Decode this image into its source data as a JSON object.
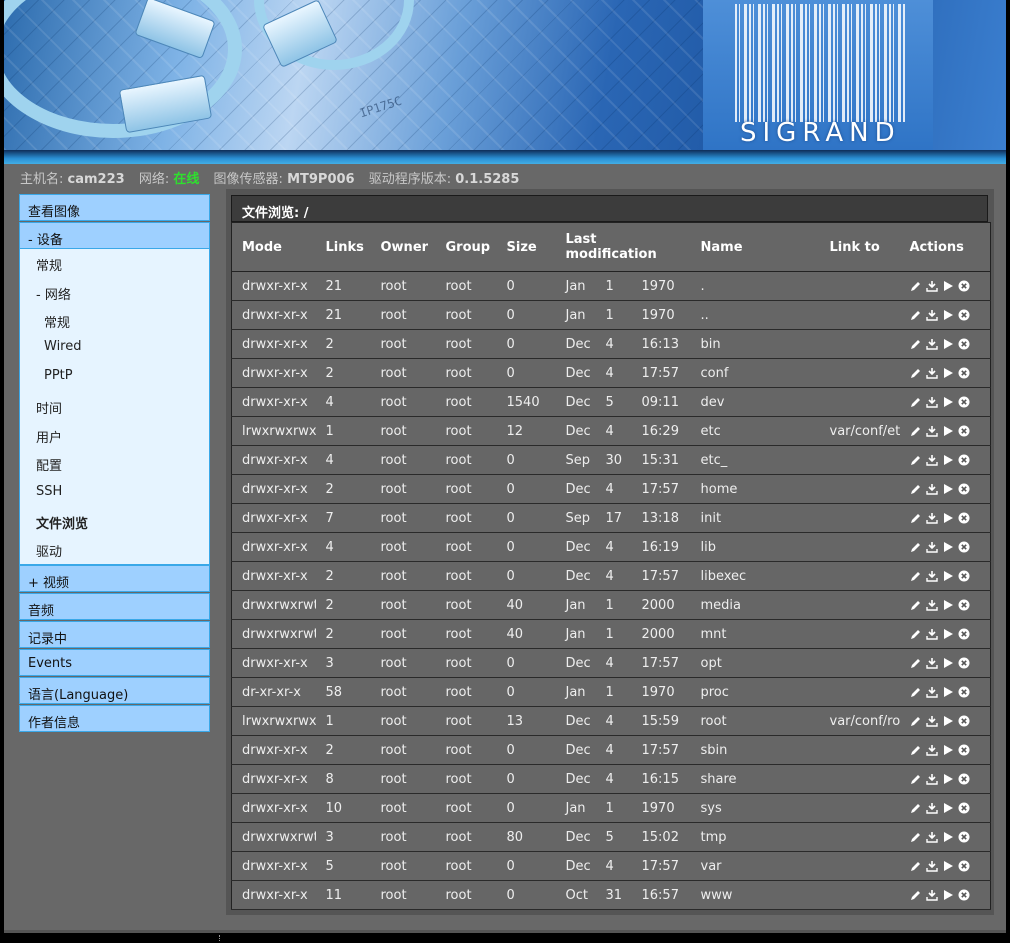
{
  "status": {
    "host_label": "主机名:",
    "host_value": "cam223",
    "network_label": "网络:",
    "network_value": "在线",
    "sensor_label": "图像传感器:",
    "sensor_value": "MT9P006",
    "driver_label": "驱动程序版本:",
    "driver_value": "0.1.5285"
  },
  "banner": {
    "logo": "SIGRAND",
    "chip_text": "IP175C"
  },
  "sidebar": {
    "view_image": "查看图像",
    "devices": "- 设备",
    "devices_sub": [
      "常规",
      "- 网络"
    ],
    "network_sub": [
      "常规",
      "Wired",
      "PPtP"
    ],
    "devices_sub2": [
      "时间",
      "用户",
      "配置",
      "SSH",
      "文件浏览",
      "驱动"
    ],
    "video": "+ 视频",
    "audio": "音频",
    "recording": "记录中",
    "events": "Events",
    "language": "语言(Language)",
    "author": "作者信息"
  },
  "file_browser": {
    "title": "文件浏览: /",
    "columns": [
      "Mode",
      "Links",
      "Owner",
      "Group",
      "Size",
      "Last modification",
      "Name",
      "Link to",
      "Actions"
    ],
    "rows": [
      {
        "mode": "drwxr-xr-x",
        "links": "21",
        "owner": "root",
        "group": "root",
        "size": "0",
        "mon": "Jan",
        "day": "1",
        "time": "1970",
        "name": ".",
        "link": ""
      },
      {
        "mode": "drwxr-xr-x",
        "links": "21",
        "owner": "root",
        "group": "root",
        "size": "0",
        "mon": "Jan",
        "day": "1",
        "time": "1970",
        "name": "..",
        "link": ""
      },
      {
        "mode": "drwxr-xr-x",
        "links": "2",
        "owner": "root",
        "group": "root",
        "size": "0",
        "mon": "Dec",
        "day": "4",
        "time": "16:13",
        "name": "bin",
        "link": ""
      },
      {
        "mode": "drwxr-xr-x",
        "links": "2",
        "owner": "root",
        "group": "root",
        "size": "0",
        "mon": "Dec",
        "day": "4",
        "time": "17:57",
        "name": "conf",
        "link": ""
      },
      {
        "mode": "drwxr-xr-x",
        "links": "4",
        "owner": "root",
        "group": "root",
        "size": "1540",
        "mon": "Dec",
        "day": "5",
        "time": "09:11",
        "name": "dev",
        "link": ""
      },
      {
        "mode": "lrwxrwxrwx",
        "links": "1",
        "owner": "root",
        "group": "root",
        "size": "12",
        "mon": "Dec",
        "day": "4",
        "time": "16:29",
        "name": "etc",
        "link": "var/conf/etc"
      },
      {
        "mode": "drwxr-xr-x",
        "links": "4",
        "owner": "root",
        "group": "root",
        "size": "0",
        "mon": "Sep",
        "day": "30",
        "time": "15:31",
        "name": "etc_",
        "link": ""
      },
      {
        "mode": "drwxr-xr-x",
        "links": "2",
        "owner": "root",
        "group": "root",
        "size": "0",
        "mon": "Dec",
        "day": "4",
        "time": "17:57",
        "name": "home",
        "link": ""
      },
      {
        "mode": "drwxr-xr-x",
        "links": "7",
        "owner": "root",
        "group": "root",
        "size": "0",
        "mon": "Sep",
        "day": "17",
        "time": "13:18",
        "name": "init",
        "link": ""
      },
      {
        "mode": "drwxr-xr-x",
        "links": "4",
        "owner": "root",
        "group": "root",
        "size": "0",
        "mon": "Dec",
        "day": "4",
        "time": "16:19",
        "name": "lib",
        "link": ""
      },
      {
        "mode": "drwxr-xr-x",
        "links": "2",
        "owner": "root",
        "group": "root",
        "size": "0",
        "mon": "Dec",
        "day": "4",
        "time": "17:57",
        "name": "libexec",
        "link": ""
      },
      {
        "mode": "drwxrwxrwt",
        "links": "2",
        "owner": "root",
        "group": "root",
        "size": "40",
        "mon": "Jan",
        "day": "1",
        "time": "2000",
        "name": "media",
        "link": ""
      },
      {
        "mode": "drwxrwxrwt",
        "links": "2",
        "owner": "root",
        "group": "root",
        "size": "40",
        "mon": "Jan",
        "day": "1",
        "time": "2000",
        "name": "mnt",
        "link": ""
      },
      {
        "mode": "drwxr-xr-x",
        "links": "3",
        "owner": "root",
        "group": "root",
        "size": "0",
        "mon": "Dec",
        "day": "4",
        "time": "17:57",
        "name": "opt",
        "link": ""
      },
      {
        "mode": "dr-xr-xr-x",
        "links": "58",
        "owner": "root",
        "group": "root",
        "size": "0",
        "mon": "Jan",
        "day": "1",
        "time": "1970",
        "name": "proc",
        "link": ""
      },
      {
        "mode": "lrwxrwxrwx",
        "links": "1",
        "owner": "root",
        "group": "root",
        "size": "13",
        "mon": "Dec",
        "day": "4",
        "time": "15:59",
        "name": "root",
        "link": "var/conf/root"
      },
      {
        "mode": "drwxr-xr-x",
        "links": "2",
        "owner": "root",
        "group": "root",
        "size": "0",
        "mon": "Dec",
        "day": "4",
        "time": "17:57",
        "name": "sbin",
        "link": ""
      },
      {
        "mode": "drwxr-xr-x",
        "links": "8",
        "owner": "root",
        "group": "root",
        "size": "0",
        "mon": "Dec",
        "day": "4",
        "time": "16:15",
        "name": "share",
        "link": ""
      },
      {
        "mode": "drwxr-xr-x",
        "links": "10",
        "owner": "root",
        "group": "root",
        "size": "0",
        "mon": "Jan",
        "day": "1",
        "time": "1970",
        "name": "sys",
        "link": ""
      },
      {
        "mode": "drwxrwxrwt",
        "links": "3",
        "owner": "root",
        "group": "root",
        "size": "80",
        "mon": "Dec",
        "day": "5",
        "time": "15:02",
        "name": "tmp",
        "link": ""
      },
      {
        "mode": "drwxr-xr-x",
        "links": "5",
        "owner": "root",
        "group": "root",
        "size": "0",
        "mon": "Dec",
        "day": "4",
        "time": "17:57",
        "name": "var",
        "link": ""
      },
      {
        "mode": "drwxr-xr-x",
        "links": "11",
        "owner": "root",
        "group": "root",
        "size": "0",
        "mon": "Oct",
        "day": "31",
        "time": "16:57",
        "name": "www",
        "link": ""
      }
    ],
    "action_icons": [
      "edit-icon",
      "download-icon",
      "run-icon",
      "delete-icon"
    ]
  },
  "colors": {
    "accent_online": "#2ee02e",
    "sidebar_bg": "#9ed0ff",
    "sidebar_sub_bg": "#e6f4ff",
    "panel_bg": "#666666"
  }
}
